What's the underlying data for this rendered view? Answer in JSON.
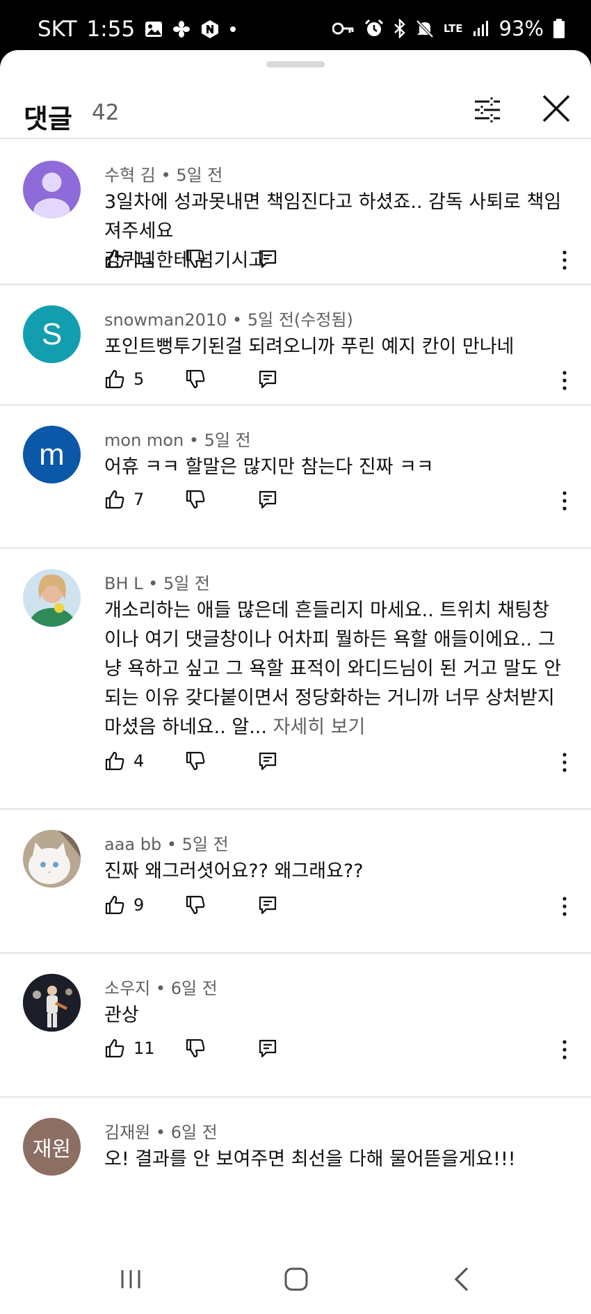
{
  "status_bar": {
    "carrier": "SKT",
    "time": "1:55",
    "battery": "93%",
    "network": "LTE"
  },
  "header": {
    "title": "댓글",
    "count": "42"
  },
  "comments": [
    {
      "author": "수혁 김",
      "time": "5일 전",
      "text": "3일차에 성과못내면 책임진다고 하셨죠.. 감독 사퇴로 책임져주세요\n강퀴님한테 넘기시고",
      "likes": "11",
      "avatar_color": "#8e6bd8"
    },
    {
      "author": "snowman2010",
      "time": "5일 전(수정됨)",
      "text": "포인트뻥투기된걸 되려오니까 푸린 예지 칸이 만나네",
      "likes": "5",
      "avatar_letter": "S",
      "avatar_color": "#129eaf"
    },
    {
      "author": "mon mon",
      "time": "5일 전",
      "text": "어휴 ㅋㅋ 할말은 많지만 참는다 진짜 ㅋㅋ",
      "likes": "7",
      "avatar_letter": "m",
      "avatar_color": "#0b57a8"
    },
    {
      "author": "BH L",
      "time": "5일 전",
      "text": "개소리하는 애들 많은데 흔들리지 마세요.. 트위치 채팅창이나 여기 댓글창이나 어차피 뭘하든 욕할 애들이에요.. 그냥 욕하고 싶고 그 욕할 표적이 와디드님이 된 거고 말도 안되는 이유 갖다붙이면서 정당화하는 거니까 너무 상처받지 마셨음 하네요.. 알...",
      "more": "자세히 보기",
      "likes": "4"
    },
    {
      "author": "aaa bb",
      "time": "5일 전",
      "text": "진짜 왜그러셧어요?? 왜그래요??",
      "likes": "9"
    },
    {
      "author": "소우지",
      "time": "6일 전",
      "text": "관상",
      "likes": "11"
    },
    {
      "author": "김재원",
      "time": "6일 전",
      "text": "오! 결과를 안 보여주면 최선을 다해 물어뜯을게요!!!",
      "avatar_letter": "재원",
      "avatar_color": "#8d6e63"
    }
  ],
  "icons": {
    "filter": "sliders-icon",
    "close": "close-icon",
    "like": "thumbs-up-icon",
    "dislike": "thumbs-down-icon",
    "reply": "reply-icon",
    "menu": "more-vertical-icon"
  },
  "colors": {
    "text": "#0f0f0f",
    "secondary": "#606060",
    "divider": "#e5e5e5"
  }
}
